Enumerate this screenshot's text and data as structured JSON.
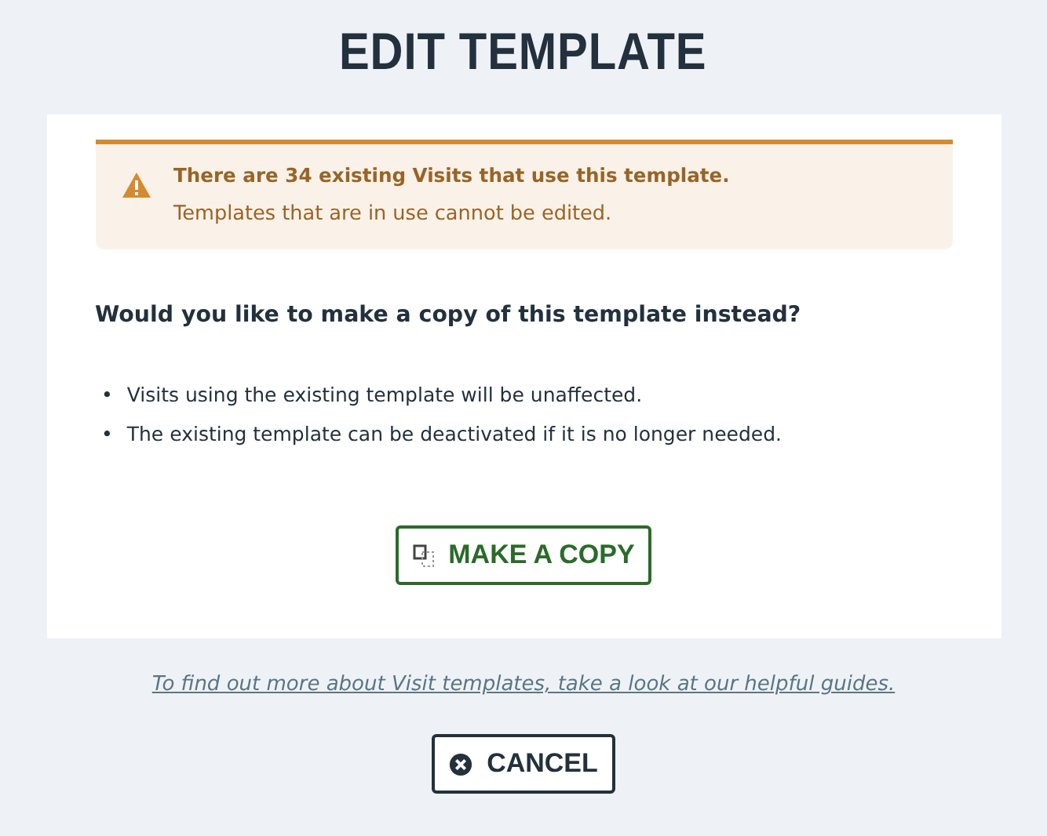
{
  "title": "EDIT TEMPLATE",
  "alert": {
    "heading": "There are 34 existing Visits that use this template.",
    "message": "Templates that are in use cannot be edited."
  },
  "question": "Would you like to make a copy of this template instead?",
  "bullets": [
    {
      "marker": "•",
      "text": "Visits using the existing template will be unaffected."
    },
    {
      "marker": "•",
      "text": "The existing template can be deactivated if it is no longer needed."
    }
  ],
  "copy_button": "MAKE A COPY",
  "guide_link": "To find out more about Visit templates, take a look at our helpful guides.",
  "cancel_button": "CANCEL"
}
